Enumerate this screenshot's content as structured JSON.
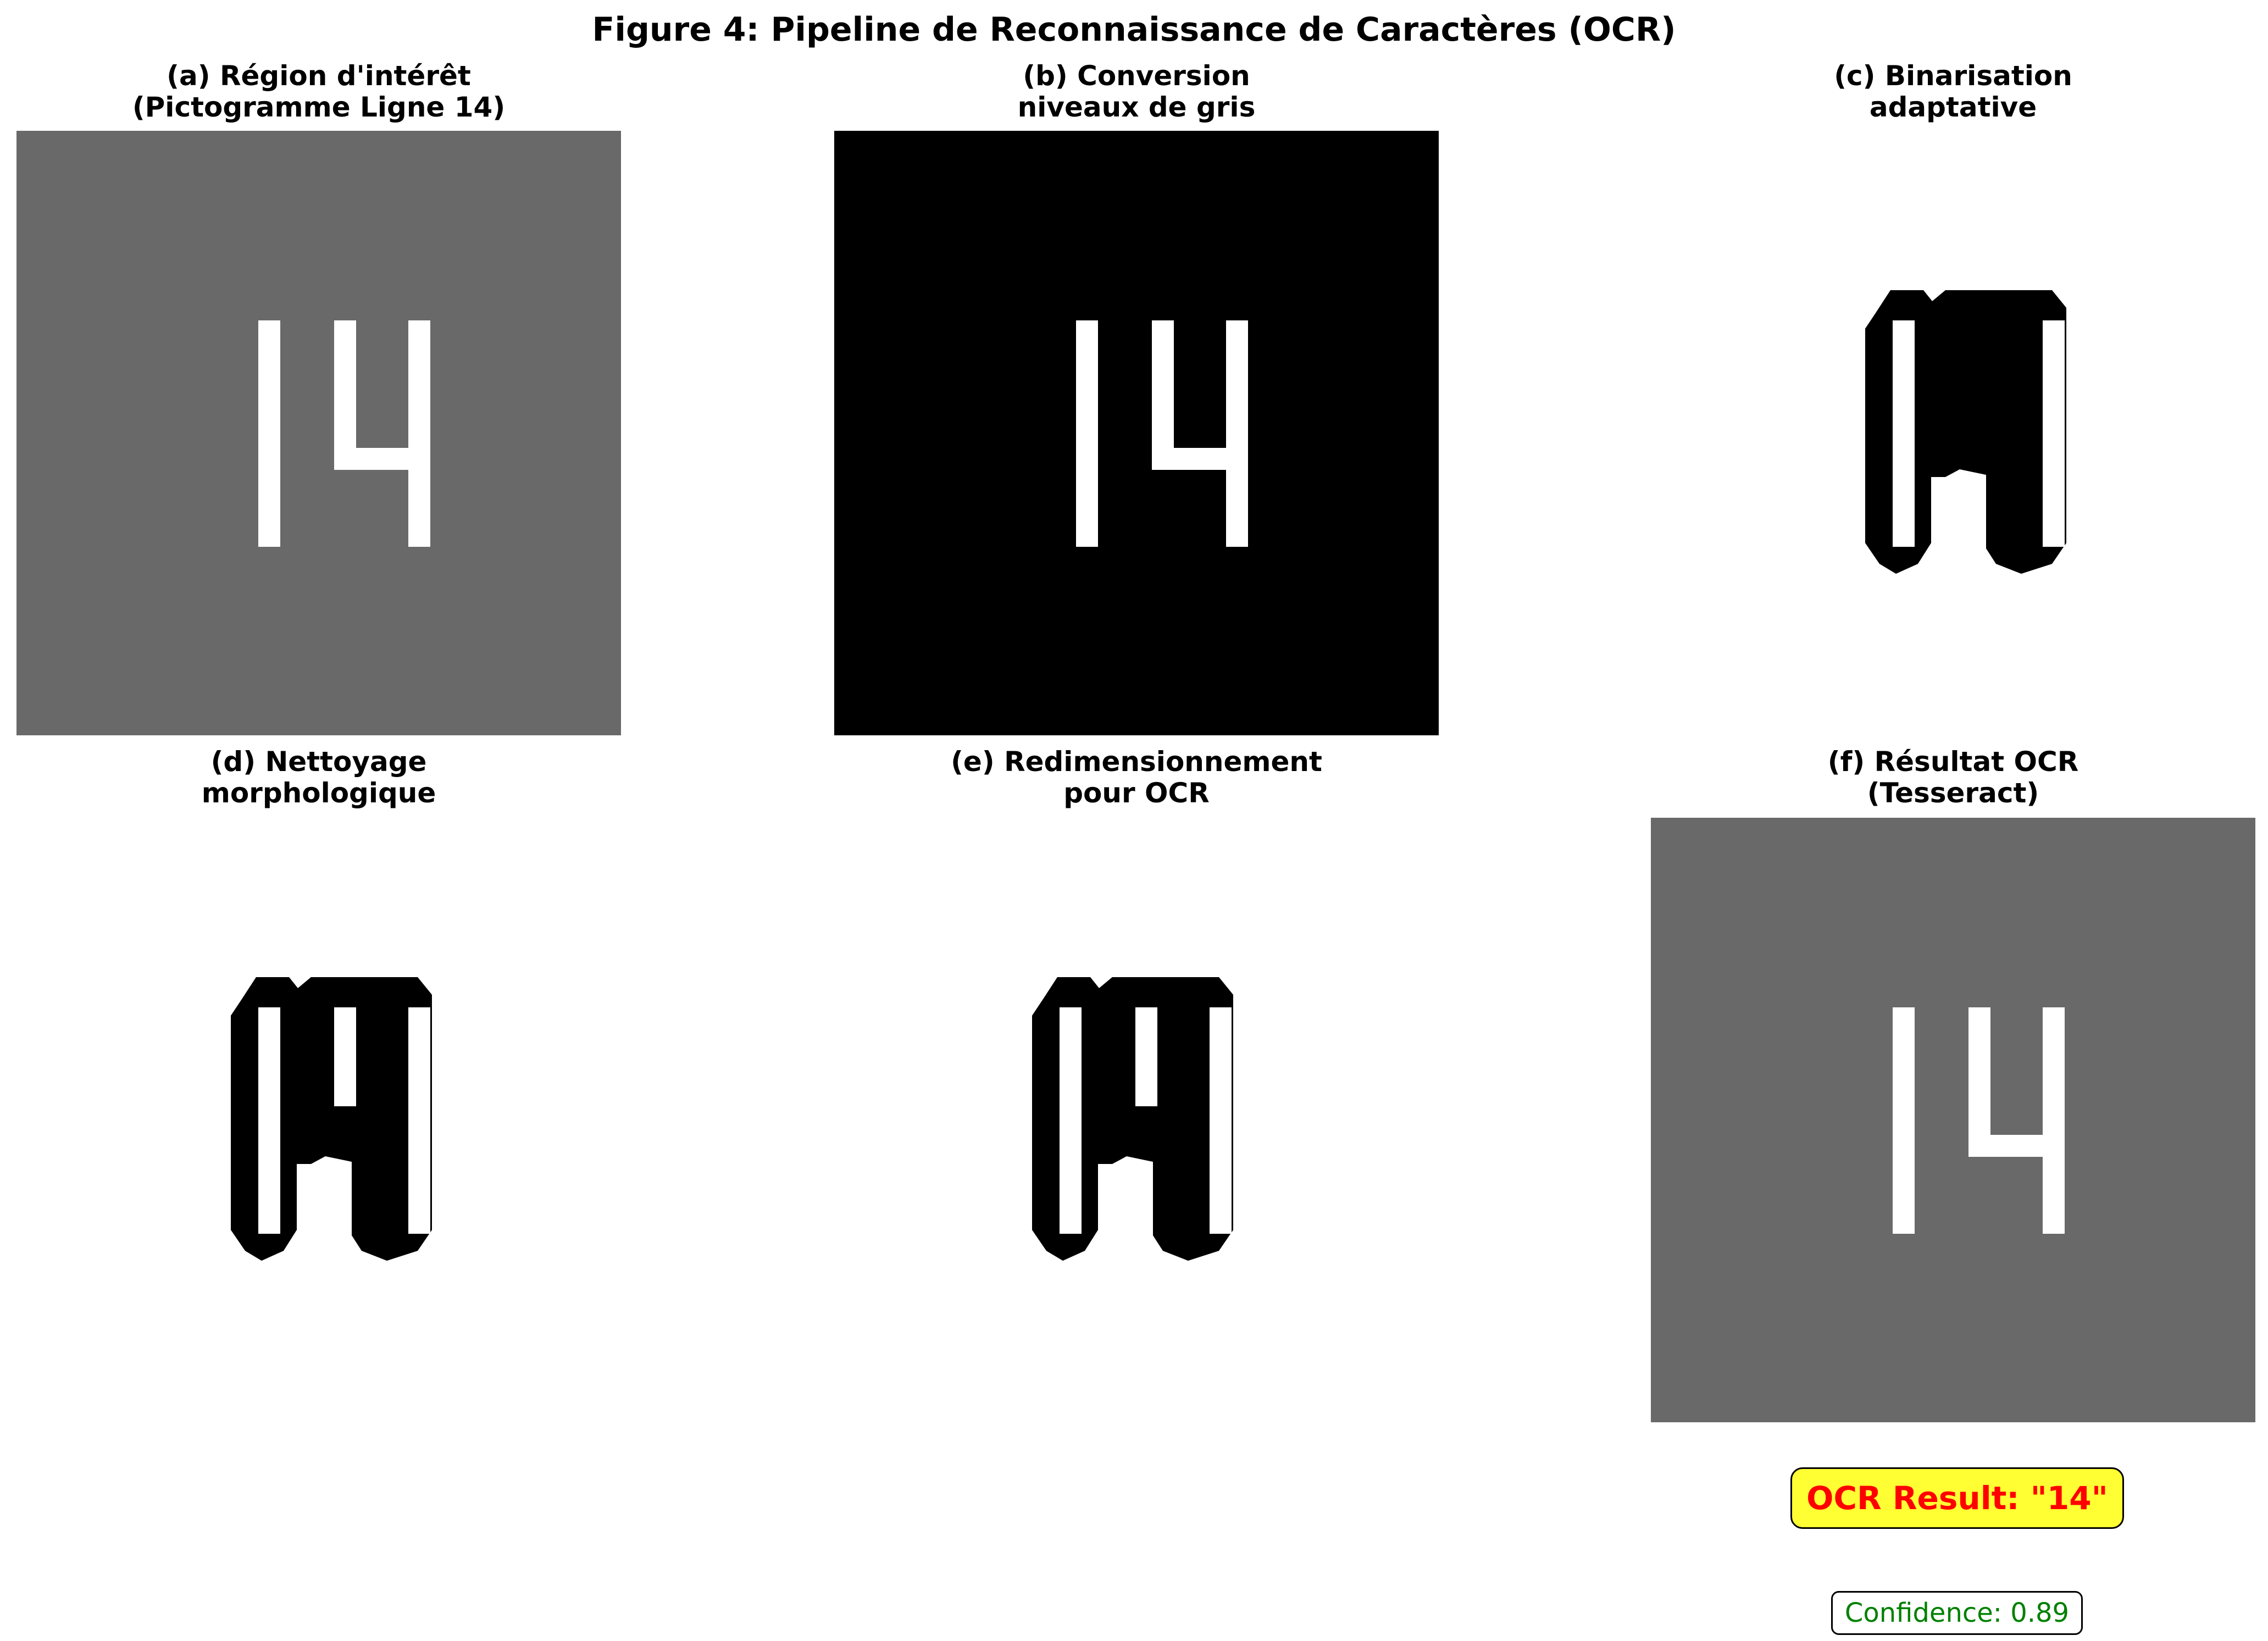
{
  "figure": {
    "title": "Figure 4: Pipeline de Reconnaissance de Caractères (OCR)"
  },
  "panels": [
    {
      "title_line1": "(a) Région d'intérêt",
      "title_line2": "(Pictogramme Ligne 14)",
      "glyph": "14",
      "background": "#696969",
      "foreground": "#ffffff"
    },
    {
      "title_line1": "(b) Conversion",
      "title_line2": "niveaux de gris",
      "glyph": "14",
      "background": "#000000",
      "foreground": "#ffffff"
    },
    {
      "title_line1": "(c) Binarisation",
      "title_line2": "adaptative",
      "glyph": "14",
      "background": "#ffffff",
      "foreground": "#000000"
    },
    {
      "title_line1": "(d) Nettoyage",
      "title_line2": "morphologique",
      "glyph": "14",
      "background": "#ffffff",
      "foreground": "#000000"
    },
    {
      "title_line1": "(e) Redimensionnement",
      "title_line2": "pour OCR",
      "glyph": "14",
      "background": "#ffffff",
      "foreground": "#000000"
    },
    {
      "title_line1": "(f) Résultat OCR",
      "title_line2": "(Tesseract)",
      "glyph": "14",
      "background": "#696969",
      "foreground": "#ffffff"
    }
  ],
  "result": {
    "ocr_label": "OCR Result: \"14\"",
    "confidence_label": "Confidence: 0.89",
    "ocr_box_color": "#ffff33",
    "ocr_text_color": "#ff0000",
    "confidence_text_color": "#008000"
  }
}
